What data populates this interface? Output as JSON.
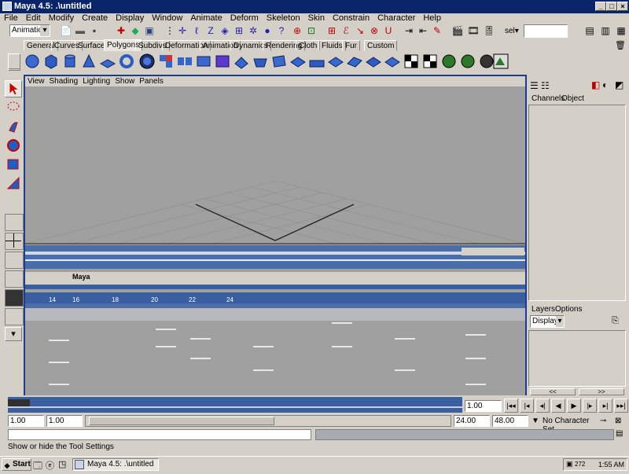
{
  "window": {
    "title": "Maya 4.5: .\\untitled"
  },
  "menubar": [
    "File",
    "Edit",
    "Modify",
    "Create",
    "Display",
    "Window",
    "Animate",
    "Deform",
    "Skeleton",
    "Skin",
    "Constrain",
    "Character",
    "Help"
  ],
  "statusline": {
    "mode_selector": "Animation",
    "sel_label": "sel▾",
    "sel_field": ""
  },
  "shelf_tabs": [
    "General",
    "Curves",
    "Surfaces",
    "Polygons",
    "Subdivs",
    "Deformation",
    "Animation",
    "Dynamics",
    "Rendering",
    "Cloth",
    "Fluids",
    "Fur",
    "Custom"
  ],
  "shelf_active_tab": "Polygons",
  "viewport_menu": [
    "View",
    "Shading",
    "Lighting",
    "Show",
    "Panels"
  ],
  "channel_box": {
    "tabs": [
      "Channels",
      "Object"
    ]
  },
  "layers": {
    "tabs": [
      "Layers",
      "Options"
    ],
    "display_selector": "Display",
    "scroll_left": "<<",
    "scroll_right": ">>"
  },
  "viewport_overlay": {
    "inner_title": "Maya",
    "frame_labels": [
      "14",
      "16",
      "18",
      "20",
      "22",
      "24"
    ]
  },
  "time_slider": {
    "current_frame": "1.00"
  },
  "range_slider": {
    "start_time": "1.00",
    "range_start": "1.00",
    "range_end": "24.00",
    "end_time": "48.00",
    "character_set": "No Character Set"
  },
  "command_line": {
    "input": ""
  },
  "help_line": "Show or hide the Tool Settings",
  "taskbar": {
    "start_label": "Start",
    "task_label": "Maya 4.5: .\\untitled",
    "tray_number": "272",
    "clock": "1:55 AM"
  },
  "accent_colors": {
    "titlebar": "#0a246a",
    "viewport_border": "#1c3c8c",
    "time_marker": "#3a5fa0"
  }
}
